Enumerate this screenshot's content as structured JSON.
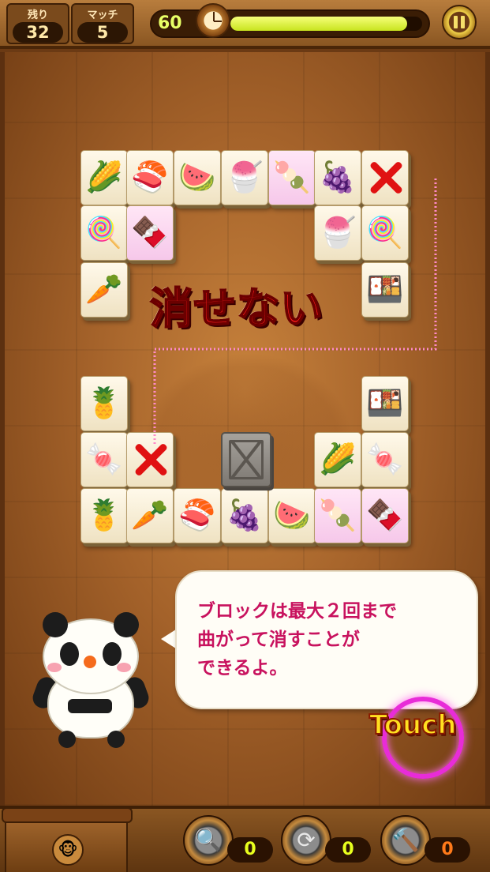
{
  "header": {
    "remaining_label": "残り",
    "remaining_value": "32",
    "match_label": "マッチ",
    "match_value": "5",
    "timer_value": "60",
    "timer_fill_fraction": 0.92,
    "timer_color": "#e8ff66",
    "pause_icon": "pause-icon"
  },
  "board": {
    "message": "消せない",
    "message_color": "#ff1a1a",
    "path_color": "#ff8ac8",
    "tiles": [
      {
        "icon": "corn",
        "glyph": "🌽",
        "pink": false
      },
      {
        "icon": "ikura-sushi",
        "glyph": "🍣",
        "pink": false
      },
      {
        "icon": "watermelon",
        "glyph": "🍉",
        "pink": false
      },
      {
        "icon": "parfait",
        "glyph": "🍧",
        "pink": false
      },
      {
        "icon": "dango",
        "glyph": "🍡",
        "pink": true
      },
      {
        "icon": "grapes",
        "glyph": "🍇",
        "pink": false
      },
      {
        "icon": "x-mark",
        "glyph": "",
        "pink": false
      },
      {
        "icon": "lollipop",
        "glyph": "🍭",
        "pink": false
      },
      {
        "icon": "checker-cake",
        "glyph": "🍫",
        "pink": true
      },
      {
        "icon": "parfait",
        "glyph": "🍧",
        "pink": false
      },
      {
        "icon": "lollipop",
        "glyph": "🍭",
        "pink": false
      },
      {
        "icon": "carrot",
        "glyph": "🥕",
        "pink": false
      },
      {
        "icon": "tamago-sushi",
        "glyph": "🍱",
        "pink": false
      },
      {
        "icon": "pineapple",
        "glyph": "🍍",
        "pink": false
      },
      {
        "icon": "tamago-sushi",
        "glyph": "🍱",
        "pink": false
      },
      {
        "icon": "candy",
        "glyph": "🍬",
        "pink": false
      },
      {
        "icon": "x-mark",
        "glyph": "",
        "pink": false
      },
      {
        "icon": "corn",
        "glyph": "🌽",
        "pink": false
      },
      {
        "icon": "candy",
        "glyph": "🍬",
        "pink": false
      },
      {
        "icon": "pineapple",
        "glyph": "🍍",
        "pink": false
      },
      {
        "icon": "carrot",
        "glyph": "🥕",
        "pink": false
      },
      {
        "icon": "ikura-sushi",
        "glyph": "🍣",
        "pink": false
      },
      {
        "icon": "grapes",
        "glyph": "🍇",
        "pink": false
      },
      {
        "icon": "watermelon",
        "glyph": "🍉",
        "pink": false
      },
      {
        "icon": "dango",
        "glyph": "🍡",
        "pink": true
      },
      {
        "icon": "checker-cake",
        "glyph": "🍫",
        "pink": true
      }
    ],
    "stone_block_icon": "stone-block-icon"
  },
  "tutorial": {
    "bubble_text": "ブロックは最大２回まで\n曲がって消すことが\nできるよ。",
    "bubble_text_color": "#c8125e",
    "character": "panda-icon",
    "touch_label": "Touch",
    "touch_color": "#ffe020"
  },
  "footer": {
    "shop_icon": "shop-icon",
    "tools": [
      {
        "icon": "magnifier-icon",
        "glyph": "🔍",
        "count": "0",
        "count_color": "#e8ff1e"
      },
      {
        "icon": "shuffle-icon",
        "glyph": "⟳",
        "count": "0",
        "count_color": "#e8ff1e"
      },
      {
        "icon": "hammer-icon",
        "glyph": "🔨",
        "count": "0",
        "count_color": "#ff7a1a"
      }
    ]
  }
}
